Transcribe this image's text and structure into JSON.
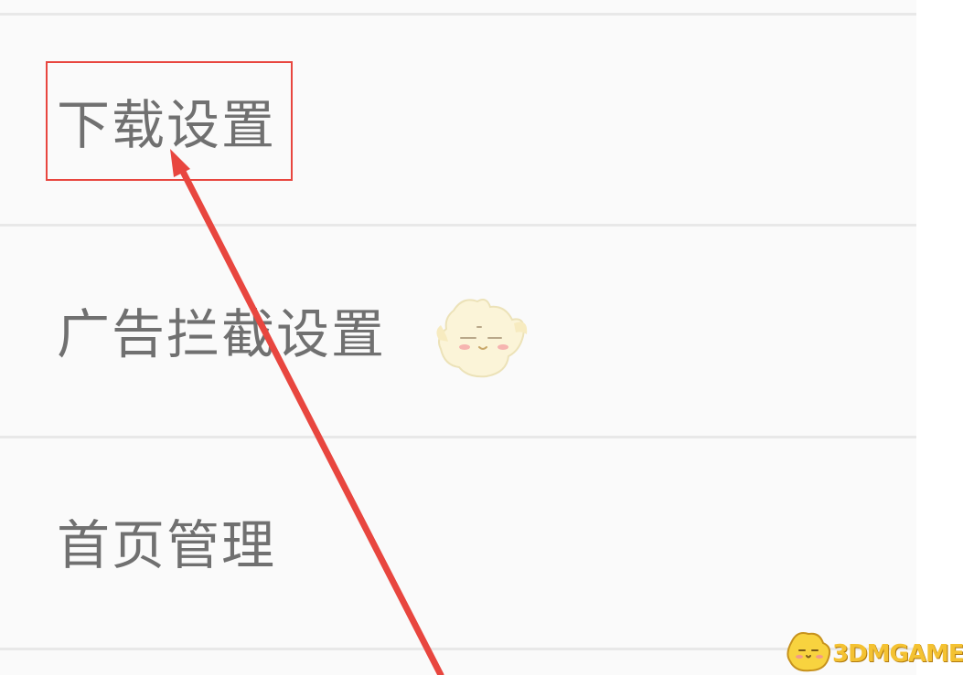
{
  "settings": {
    "items": [
      {
        "label": "下载设置",
        "highlighted": true
      },
      {
        "label": "广告拦截设置",
        "highlighted": false
      },
      {
        "label": "首页管理",
        "highlighted": false
      }
    ]
  },
  "annotation": {
    "highlight_color": "#e8463f",
    "arrow_color": "#e8463f",
    "arrow_target": "下载设置"
  },
  "mascot": {
    "icon": "chick-mascot-icon"
  },
  "watermark": {
    "icon": "chick-logo-icon",
    "text": "3DMGAME",
    "color": "#f4c232"
  },
  "colors": {
    "background": "#fafafa",
    "divider": "#e8e8e8",
    "label_text": "#707070"
  }
}
